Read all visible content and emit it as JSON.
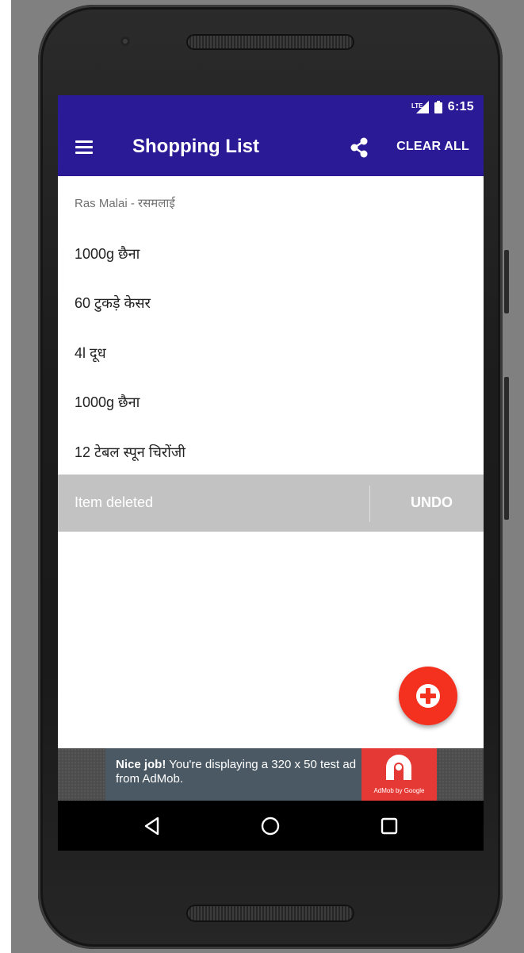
{
  "status_bar": {
    "time": "6:15"
  },
  "app_bar": {
    "title": "Shopping List",
    "clear_all_label": "CLEAR ALL",
    "menu_icon": "menu-icon",
    "share_icon": "share-icon"
  },
  "list": {
    "header": "Ras Malai - रसमलाई",
    "items": [
      "1000g छैना",
      "60 टुकड़े केसर",
      "4l दूध",
      "1000g छैना",
      "12 टेबल स्पून चिरोंजी"
    ]
  },
  "snackbar": {
    "message": "Item deleted",
    "action": "UNDO"
  },
  "fab": {
    "icon": "add-icon",
    "color": "#f4301f"
  },
  "ad": {
    "bold_text": "Nice job!",
    "text": " You're displaying a 320 x 50 test ad from AdMob.",
    "logo_caption": "AdMob by Google"
  },
  "colors": {
    "primary": "#2b1a95",
    "accent": "#f4301f",
    "snackbar": "#c2c2c2"
  },
  "nav_bar": {
    "back_icon": "back-triangle-icon",
    "home_icon": "home-circle-icon",
    "recents_icon": "recents-square-icon"
  }
}
